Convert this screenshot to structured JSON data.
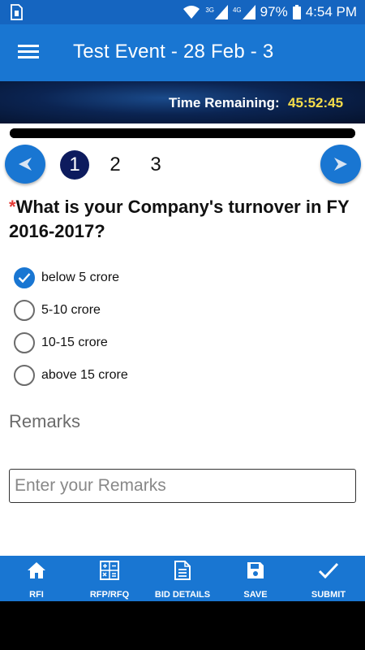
{
  "status_bar": {
    "battery": "97%",
    "time": "4:54 PM",
    "signal_1": "3G",
    "signal_2": "4G"
  },
  "app_bar": {
    "title": "Test Event - 28 Feb - 3"
  },
  "timer": {
    "label": "Time Remaining:",
    "value": "45:52:45"
  },
  "pagination": {
    "pages": [
      "1",
      "2",
      "3"
    ],
    "current": "1"
  },
  "question": {
    "required_marker": "*",
    "text": "What is your Company's turnover in FY 2016-2017?",
    "options": [
      {
        "label": "below 5 crore",
        "selected": true
      },
      {
        "label": "5-10 crore",
        "selected": false
      },
      {
        "label": "10-15 crore",
        "selected": false
      },
      {
        "label": "above 15 crore",
        "selected": false
      }
    ]
  },
  "remarks": {
    "label": "Remarks",
    "placeholder": "Enter your Remarks"
  },
  "bottom_nav": {
    "items": [
      {
        "label": "RFI",
        "icon": "home-icon"
      },
      {
        "label": "RFP/RFQ",
        "icon": "calculator-icon"
      },
      {
        "label": "BID DETAILS",
        "icon": "document-icon"
      },
      {
        "label": "SAVE",
        "icon": "floppy-disk-icon"
      },
      {
        "label": "SUBMIT",
        "icon": "checkmark-icon"
      }
    ]
  },
  "colors": {
    "primary": "#1976d2",
    "status_bar": "#1565c0",
    "active_page": "#0d1b5e",
    "timer_value": "#f5dc4a",
    "required": "#e53935"
  }
}
